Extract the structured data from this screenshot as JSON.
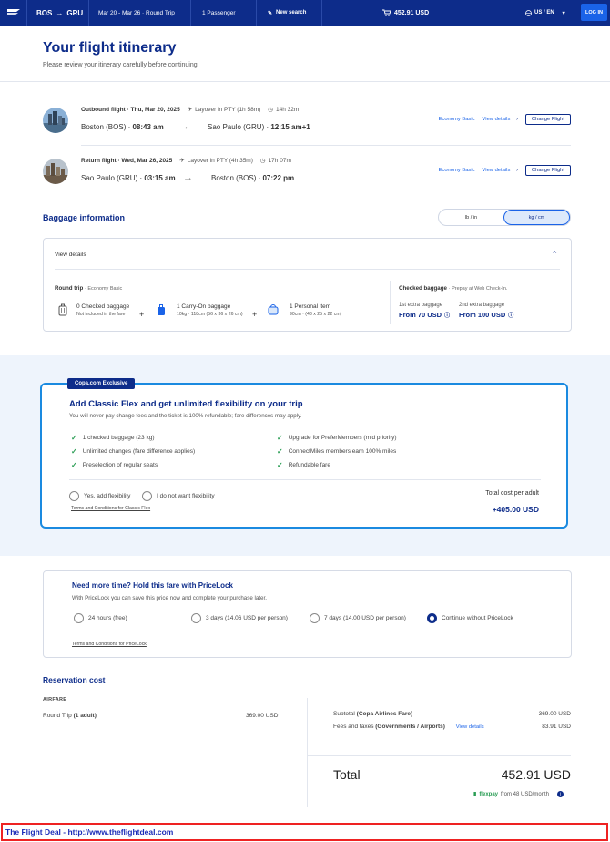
{
  "header": {
    "origin": "BOS",
    "destination": "GRU",
    "dates": "Mar 20 - Mar 26 · Round Trip",
    "passengers": "1 Passenger",
    "new_search": "New search",
    "cart_total": "452.91 USD",
    "language": "US / EN",
    "login": "LOG IN"
  },
  "page": {
    "title": "Your flight itinerary",
    "subtitle": "Please review your itinerary carefully before continuing."
  },
  "flights": [
    {
      "label": "Outbound flight · Thu, Mar 20, 2025",
      "layover": "Layover in PTY (1h 58m)",
      "duration": "14h 32m",
      "from": "Boston (BOS) · ",
      "from_time": "08:43 am",
      "to": "Sao Paulo (GRU) · ",
      "to_time": "12:15 am+1",
      "fare": "Economy Basic",
      "view_details": "View details",
      "change": "Change Flight"
    },
    {
      "label": "Return flight · Wed, Mar 26, 2025",
      "layover": "Layover in PTY (4h 35m)",
      "duration": "17h 07m",
      "from": "Sao Paulo (GRU) · ",
      "from_time": "03:15 am",
      "to": "Boston (BOS) · ",
      "to_time": "07:22 pm",
      "fare": "Economy Basic",
      "view_details": "View details",
      "change": "Change Flight"
    }
  ],
  "baggage": {
    "title": "Baggage information",
    "unit_lb": "lb / in",
    "unit_kg": "kg / cm",
    "view_details": "View details",
    "round_trip": "Round trip",
    "round_trip_fare": "· Economy Basic",
    "items": [
      {
        "title": "0 Checked baggage",
        "sub": "Not included in the fare"
      },
      {
        "title": "1 Carry-On baggage",
        "sub": "10kg · 118cm (56 x 36 x 26 cm)"
      },
      {
        "title": "1 Personal item",
        "sub": "90cm · (43 x 25 x 22 cm)"
      }
    ],
    "checked_title": "Checked baggage",
    "checked_note": "· Prepay at Web Check-In.",
    "extras": [
      {
        "label": "1st extra baggage",
        "price": "From 70 USD"
      },
      {
        "label": "2nd extra baggage",
        "price": "From 100 USD"
      }
    ]
  },
  "flex": {
    "badge": "Copa.com Exclusive",
    "title": "Add Classic Flex and get unlimited flexibility on your trip",
    "description": "You will never pay change fees and the ticket is 100% refundable; fare differences may apply.",
    "benefits_left": [
      "1 checked baggage (23 kg)",
      "Unlimited changes (fare difference applies)",
      "Preselection of regular seats"
    ],
    "benefits_right": [
      "Upgrade for PreferMembers (mid priority)",
      "ConnectMiles members earn 100% miles",
      "Refundable fare"
    ],
    "opt_yes": "Yes, add flexibility",
    "opt_no": "I do not want flexibility",
    "terms": "Terms and Conditions for Classic Flex",
    "total_label": "Total cost per adult",
    "total_value": "+405.00 USD"
  },
  "pricelock": {
    "title": "Need more time? Hold this fare with PriceLock",
    "description": "With PriceLock you can save this price now and complete your purchase later.",
    "options": [
      "24 hours (free)",
      "3 days (14.06 USD per person)",
      "7 days (14.00 USD per person)",
      "Continue without PriceLock"
    ],
    "terms": "Terms and Conditions for PriceLock"
  },
  "reservation": {
    "title": "Reservation cost",
    "airfare_label": "AIRFARE",
    "round_trip_label": "Round Trip",
    "round_trip_qty": "(1 adult)",
    "round_trip_value": "369.00 USD",
    "subtotal_label": "Subtotal",
    "subtotal_note": "(Copa Airlines Fare)",
    "subtotal_value": "369.00 USD",
    "fees_label": "Fees and taxes",
    "fees_note": "(Governments / Airports)",
    "fees_link": "View details",
    "fees_value": "83.91 USD",
    "total_label": "Total",
    "total_value": "452.91 USD",
    "flexpay_brand": "flexpay",
    "flexpay_text": "from 48 USD/month"
  },
  "banner": "The Flight Deal - http://www.theflightdeal.com"
}
